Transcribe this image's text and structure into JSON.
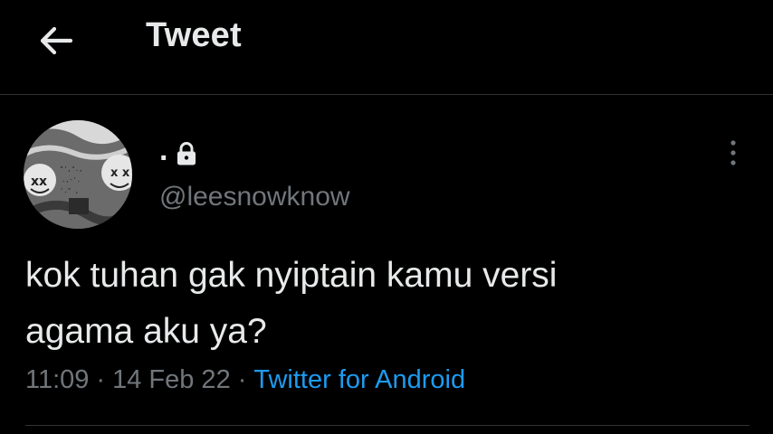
{
  "header": {
    "back_icon": "arrow-left-icon",
    "title": "Tweet"
  },
  "tweet": {
    "author": {
      "display_name": ".",
      "protected_icon": "lock-icon",
      "username": "@leesnowknow",
      "avatar_icon": "avatar-image"
    },
    "more_icon": "more-vertical-icon",
    "text_line1": "kok tuhan gak nyiptain kamu versi",
    "text_line2": "agama aku ya?",
    "time": "11:09",
    "date": "14 Feb 22",
    "separator": "·",
    "source": "Twitter for Android"
  },
  "colors": {
    "background": "#000000",
    "text_primary": "#e7e9ea",
    "text_secondary": "#71767b",
    "link": "#1d9bf0",
    "divider": "#2f3336"
  }
}
